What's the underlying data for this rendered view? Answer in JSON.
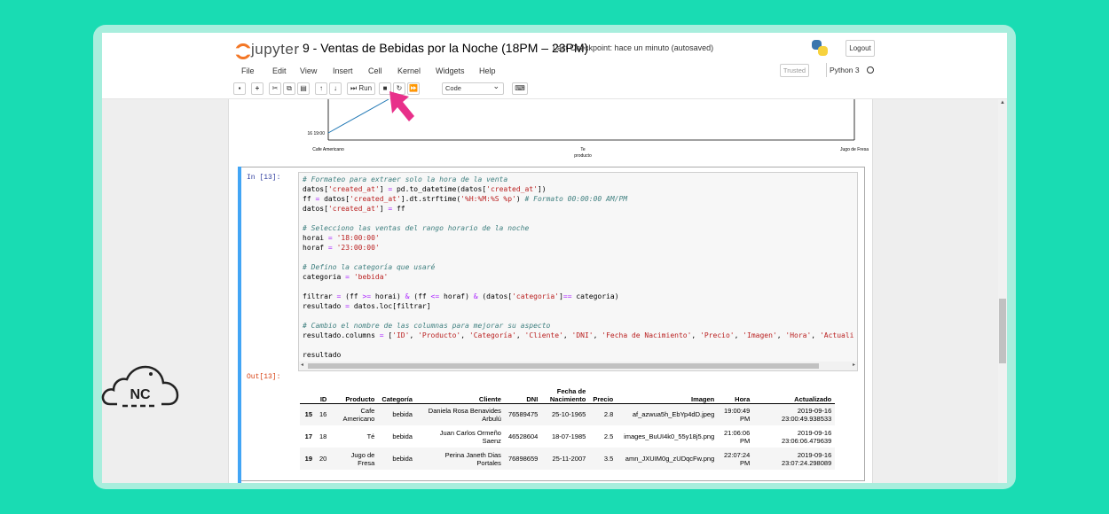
{
  "header": {
    "logo_text": "jupyter",
    "notebook_title": "9 - Ventas de Bebidas por la Noche (18PM – 23PM)",
    "checkpoint": "Last Checkpoint: hace un minuto  (autosaved)",
    "logout_label": "Logout"
  },
  "menu": [
    "File",
    "Edit",
    "View",
    "Insert",
    "Cell",
    "Kernel",
    "Widgets",
    "Help"
  ],
  "trusted_label": "Trusted",
  "kernel_name": "Python 3",
  "toolbar": {
    "run_label": "Run",
    "cell_type": "Code"
  },
  "chart_fragment": {
    "y_tick": "16 19:00",
    "x_ticks": [
      "Cafe Americano",
      "Te",
      "Jugo de Fresa"
    ],
    "x_label": "producto"
  },
  "cell": {
    "in_prompt": "In [13]:",
    "out_prompt": "Out[13]:"
  },
  "table": {
    "columns": [
      "",
      "ID",
      "Producto",
      "Categoría",
      "Cliente",
      "DNI",
      "Fecha de Nacimiento",
      "Precio",
      "Imagen",
      "Hora",
      "Actualizado"
    ],
    "rows": [
      [
        "15",
        "16",
        "Cafe Americano",
        "bebida",
        "Daniela Rosa Benavides Arbulú",
        "76589475",
        "25-10-1965",
        "2.8",
        "af_azwua5h_EbYp4dD.jpeg",
        "19:00:49 PM",
        "2019-09-16 23:00:49.938533"
      ],
      [
        "17",
        "18",
        "Té",
        "bebida",
        "Juan Carlos Ormeño Saenz",
        "46528604",
        "18-07-1985",
        "2.5",
        "images_BuUI4k0_55y18j5.png",
        "21:06:06 PM",
        "2019-09-16 23:06:06.479639"
      ],
      [
        "19",
        "20",
        "Jugo de Fresa",
        "bebida",
        "Perina Janeth Dias Portales",
        "76898659",
        "25-11-2007",
        "3.5",
        "amn_JXUIM0g_zUDqcFw.png",
        "22:07:24 PM",
        "2019-09-16 23:07:24.298089"
      ]
    ]
  },
  "brand_logo_text": "NC",
  "colors": {
    "background": "#19dcb3",
    "cell_focus": "#42a5f5",
    "arrow": "#e8308a",
    "jupyter_orange": "#f37726"
  }
}
